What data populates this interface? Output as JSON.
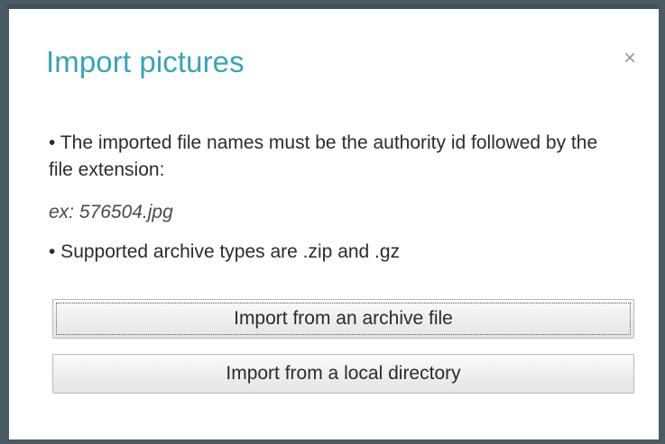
{
  "dialog": {
    "title": "Import pictures",
    "close_icon": "×",
    "instructions": {
      "line1": "• The imported file names must be the authority id followed by the file extension:",
      "example": "ex: 576504.jpg",
      "line2": "• Supported archive types are .zip and .gz"
    },
    "buttons": {
      "archive_label": "Import from an archive file",
      "directory_label": "Import from a local directory"
    }
  },
  "colors": {
    "title": "#3aa3b5",
    "frame": "#4a5a63",
    "close_icon": "#9a9a9a"
  }
}
